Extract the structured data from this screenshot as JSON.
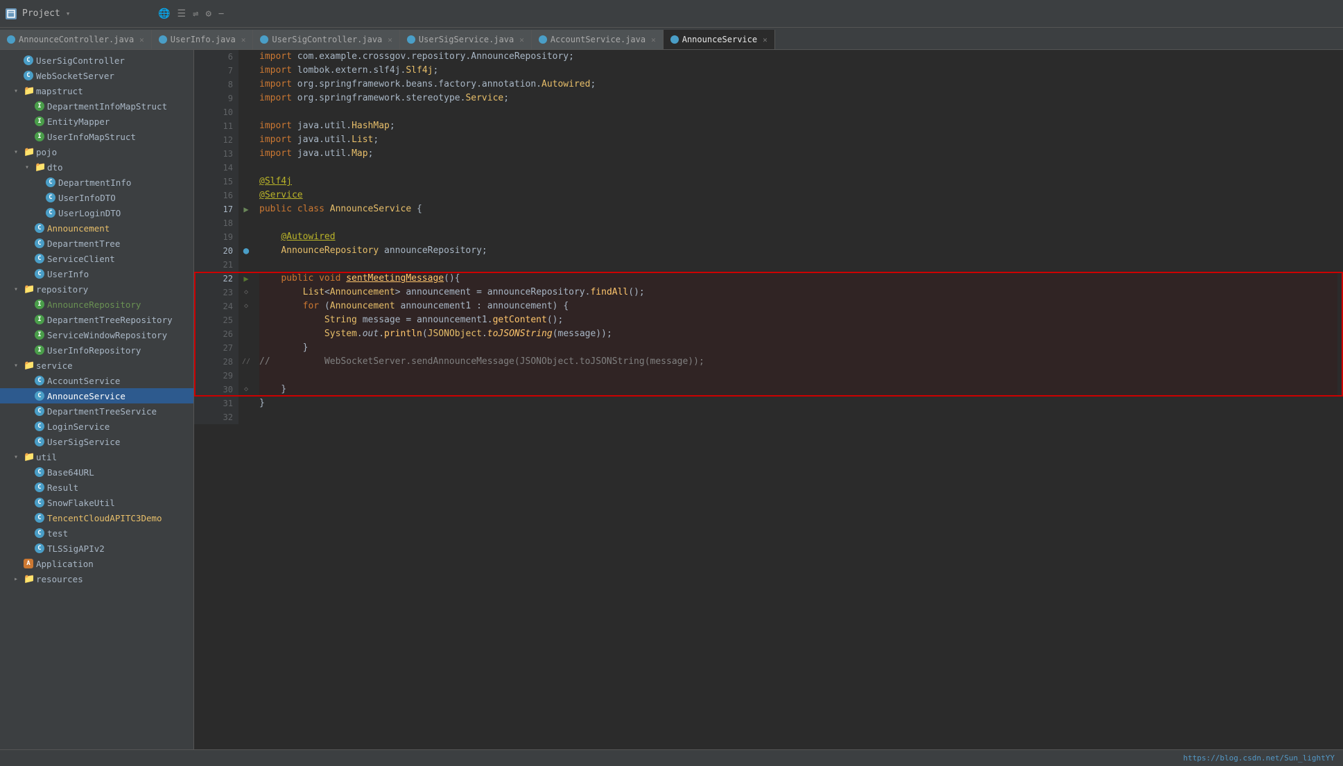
{
  "titleBar": {
    "projectLabel": "Project",
    "dropdownArrow": "▾",
    "icons": [
      "🌐",
      "≡",
      "⇌",
      "⚙",
      "−"
    ]
  },
  "tabs": [
    {
      "id": "tab1",
      "label": "AnnounceController.java",
      "active": false
    },
    {
      "id": "tab2",
      "label": "UserInfo.java",
      "active": false
    },
    {
      "id": "tab3",
      "label": "UserSigController.java",
      "active": false
    },
    {
      "id": "tab4",
      "label": "UserSigService.java",
      "active": false
    },
    {
      "id": "tab5",
      "label": "AccountService.java",
      "active": false
    },
    {
      "id": "tab6",
      "label": "AnnounceService",
      "active": true
    }
  ],
  "sidebar": {
    "items": [
      {
        "level": 0,
        "type": "class-blue",
        "label": "UserSigController"
      },
      {
        "level": 0,
        "type": "class-blue",
        "label": "WebSocketServer"
      },
      {
        "level": 0,
        "type": "folder-open",
        "label": "mapstruct"
      },
      {
        "level": 1,
        "type": "class-green",
        "label": "DepartmentInfoMapStruct"
      },
      {
        "level": 1,
        "type": "class-green",
        "label": "EntityMapper"
      },
      {
        "level": 1,
        "type": "class-green",
        "label": "UserInfoMapStruct"
      },
      {
        "level": 0,
        "type": "folder-open",
        "label": "pojo"
      },
      {
        "level": 1,
        "type": "folder-open",
        "label": "dto"
      },
      {
        "level": 2,
        "type": "class-blue",
        "label": "DepartmentInfo"
      },
      {
        "level": 2,
        "type": "class-blue",
        "label": "UserInfoDTO"
      },
      {
        "level": 2,
        "type": "class-blue",
        "label": "UserLoginDTO"
      },
      {
        "level": 1,
        "type": "class-blue",
        "label": "Announcement",
        "color": "yellow"
      },
      {
        "level": 1,
        "type": "class-blue",
        "label": "DepartmentTree"
      },
      {
        "level": 1,
        "type": "class-blue",
        "label": "ServiceClient"
      },
      {
        "level": 1,
        "type": "class-blue",
        "label": "UserInfo"
      },
      {
        "level": 0,
        "type": "folder-open",
        "label": "repository"
      },
      {
        "level": 1,
        "type": "class-green",
        "label": "AnnounceRepository",
        "color": "green-text"
      },
      {
        "level": 1,
        "type": "class-green",
        "label": "DepartmentTreeRepository"
      },
      {
        "level": 1,
        "type": "class-green",
        "label": "ServiceWindowRepository"
      },
      {
        "level": 1,
        "type": "class-green",
        "label": "UserInfoRepository"
      },
      {
        "level": 0,
        "type": "folder-open",
        "label": "service"
      },
      {
        "level": 1,
        "type": "class-blue",
        "label": "AccountService"
      },
      {
        "level": 1,
        "type": "class-blue",
        "label": "AnnounceService",
        "selected": true
      },
      {
        "level": 1,
        "type": "class-blue",
        "label": "DepartmentTreeService"
      },
      {
        "level": 1,
        "type": "class-blue",
        "label": "LoginService"
      },
      {
        "level": 1,
        "type": "class-blue",
        "label": "UserSigService"
      },
      {
        "level": 0,
        "type": "folder-open",
        "label": "util"
      },
      {
        "level": 1,
        "type": "class-blue",
        "label": "Base64URL"
      },
      {
        "level": 1,
        "type": "class-blue",
        "label": "Result"
      },
      {
        "level": 1,
        "type": "class-blue",
        "label": "SnowFlakeUtil",
        "color": "special"
      },
      {
        "level": 1,
        "type": "class-blue",
        "label": "TencentCloudAPITC3Demo",
        "color": "yellow-text"
      },
      {
        "level": 1,
        "type": "class-blue",
        "label": "test"
      },
      {
        "level": 1,
        "type": "class-blue",
        "label": "TLSSigAPIv2"
      },
      {
        "level": 0,
        "type": "class-blue",
        "label": "Application",
        "color": "special2"
      },
      {
        "level": 0,
        "type": "folder-open",
        "label": "resources"
      }
    ]
  },
  "code": {
    "lines": [
      {
        "num": 6,
        "text": "import com.example.crossgov.repository.AnnounceRepository;"
      },
      {
        "num": 7,
        "text": "import lombok.extern.slf4j.Slf4j;"
      },
      {
        "num": 8,
        "text": "import org.springframework.beans.factory.annotation.Autowired;"
      },
      {
        "num": 9,
        "text": "import org.springframework.stereotype.Service;"
      },
      {
        "num": 10,
        "text": ""
      },
      {
        "num": 11,
        "text": "import java.util.HashMap;"
      },
      {
        "num": 12,
        "text": "import java.util.List;"
      },
      {
        "num": 13,
        "text": "import java.util.Map;"
      },
      {
        "num": 14,
        "text": ""
      },
      {
        "num": 15,
        "text": "@Slf4j"
      },
      {
        "num": 16,
        "text": "@Service"
      },
      {
        "num": 17,
        "text": "public class AnnounceService {"
      },
      {
        "num": 18,
        "text": ""
      },
      {
        "num": 19,
        "text": "    @Autowired"
      },
      {
        "num": 20,
        "text": "    AnnounceRepository announceRepository;"
      },
      {
        "num": 21,
        "text": ""
      },
      {
        "num": 22,
        "text": "    public void sentMeetingMessage(){"
      },
      {
        "num": 23,
        "text": "        List<Announcement> announcement = announceRepository.findAll();"
      },
      {
        "num": 24,
        "text": "        for (Announcement announcement1 : announcement) {"
      },
      {
        "num": 25,
        "text": "            String message = announcement1.getContent();"
      },
      {
        "num": 26,
        "text": "            System.out.println(JSONObject.toJSONString(message));"
      },
      {
        "num": 27,
        "text": "        }"
      },
      {
        "num": 28,
        "text": "//          WebSocketServer.sendAnnounceMessage(JSONObject.toJSONString(message));"
      },
      {
        "num": 29,
        "text": ""
      },
      {
        "num": 30,
        "text": "    }"
      },
      {
        "num": 31,
        "text": "}"
      },
      {
        "num": 32,
        "text": ""
      }
    ]
  },
  "statusBar": {
    "url": "https://blog.csdn.net/Sun_lightYY"
  }
}
